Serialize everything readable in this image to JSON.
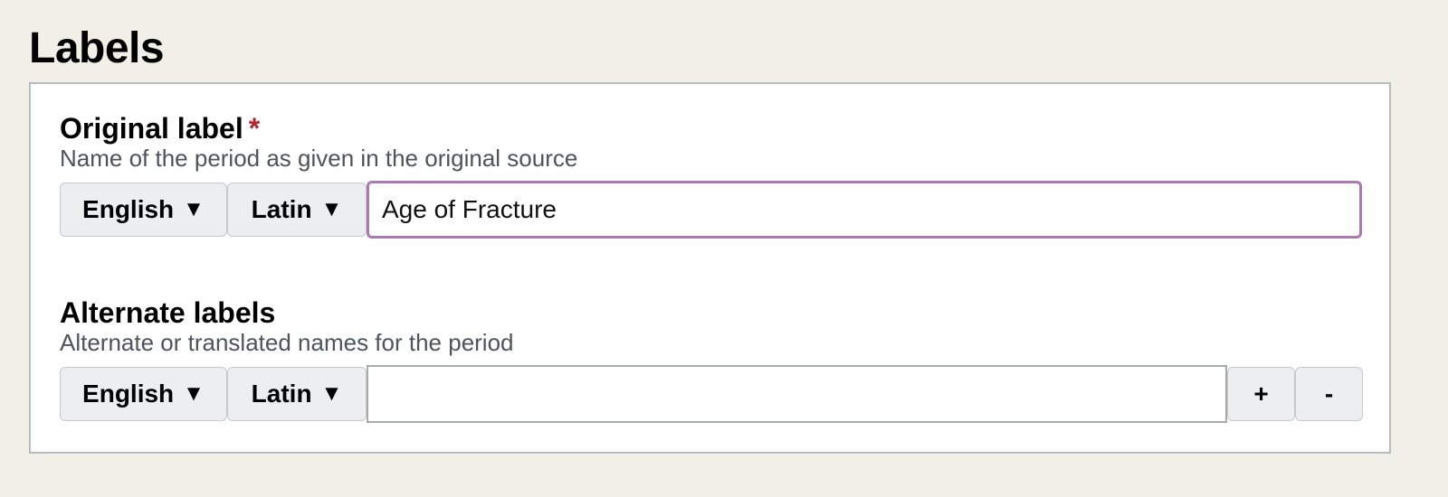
{
  "page_title": "Labels",
  "original_label": {
    "title": "Original label",
    "required_marker": "*",
    "help": "Name of the period as given in the original source",
    "language_button": "English",
    "script_button": "Latin",
    "caret_icon": "▼",
    "value": "Age of Fracture"
  },
  "alternate_labels": {
    "title": "Alternate labels",
    "help": "Alternate or translated names for the period",
    "language_button": "English",
    "script_button": "Latin",
    "caret_icon": "▼",
    "value": "",
    "add_label": "+",
    "remove_label": "-"
  },
  "colors": {
    "background": "#f2efe8",
    "required": "#b3262d",
    "focus_border": "#a97bb0"
  }
}
